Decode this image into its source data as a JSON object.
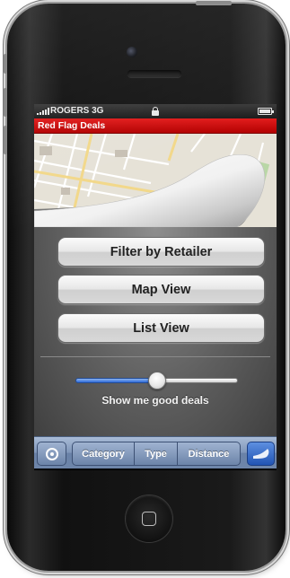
{
  "status_bar": {
    "carrier": "ROGERS 3G",
    "signal_icon": "signal-bars-icon",
    "lock_icon": "lock-icon",
    "battery_icon": "battery-icon",
    "battery_level": 0.85
  },
  "app": {
    "title": "Red Flag Deals",
    "accent_color": "#d40f0f"
  },
  "main": {
    "buttons": [
      {
        "label": "Filter by Retailer"
      },
      {
        "label": "Map View"
      },
      {
        "label": "List View"
      }
    ],
    "slider": {
      "label": "Show me good deals",
      "value": 0.5
    }
  },
  "toolbar": {
    "locate_icon": "crosshair-locate-icon",
    "segments": [
      {
        "label": "Category"
      },
      {
        "label": "Type"
      },
      {
        "label": "Distance"
      }
    ],
    "page_curl_icon": "page-curl-icon"
  }
}
